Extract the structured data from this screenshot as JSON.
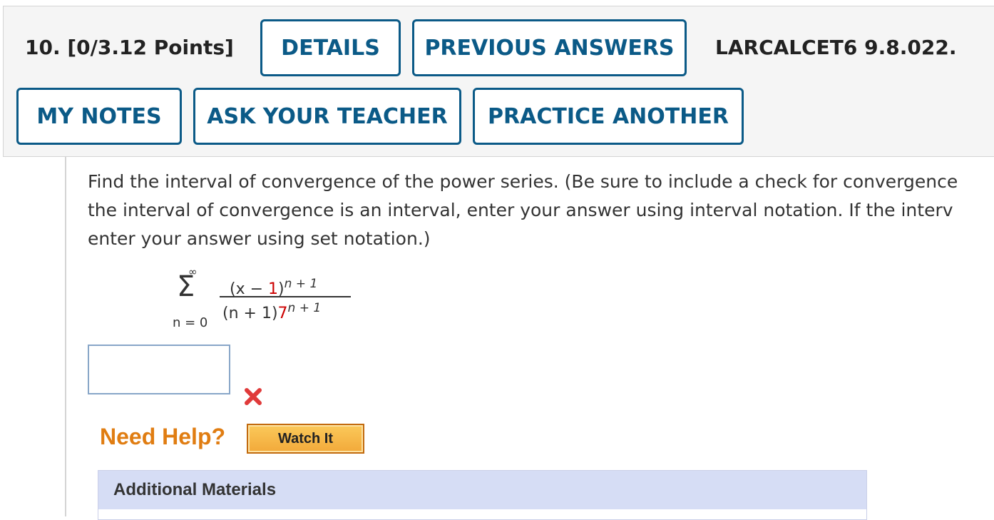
{
  "header": {
    "question_label": "10.  [0/3.12 Points]",
    "details_label": "DETAILS",
    "previous_answers_label": "PREVIOUS ANSWERS",
    "course_code": "LARCALCET6 9.8.022.",
    "my_notes_label": "MY NOTES",
    "ask_teacher_label": "ASK YOUR TEACHER",
    "practice_another_label": "PRACTICE ANOTHER"
  },
  "question": {
    "line1": "Find the interval of convergence of the power series. (Be sure to include a check for convergence",
    "line2": "the interval of convergence is an interval, enter your answer using interval notation. If the interv",
    "line3": "enter your answer using set notation.)",
    "series": {
      "upper_limit": "∞",
      "sigma": "Σ",
      "lower_limit": "n = 0",
      "numerator_open": "(x − ",
      "numerator_value": "1",
      "numerator_close": ")",
      "numerator_exponent": "n + 1",
      "denominator_base": "(n + 1)",
      "denominator_value": "7",
      "denominator_exponent": "n + 1"
    }
  },
  "answer": {
    "value": "",
    "status": "incorrect",
    "status_icon": "x-mark-icon",
    "status_color": "#e03a3a"
  },
  "help": {
    "label": "Need Help?",
    "watch_label": "Watch It"
  },
  "additional_materials": {
    "label": "Additional Materials"
  },
  "colors": {
    "button_border": "#0b5a87",
    "help_text": "#e07d12",
    "accent_red": "#cc0000"
  }
}
